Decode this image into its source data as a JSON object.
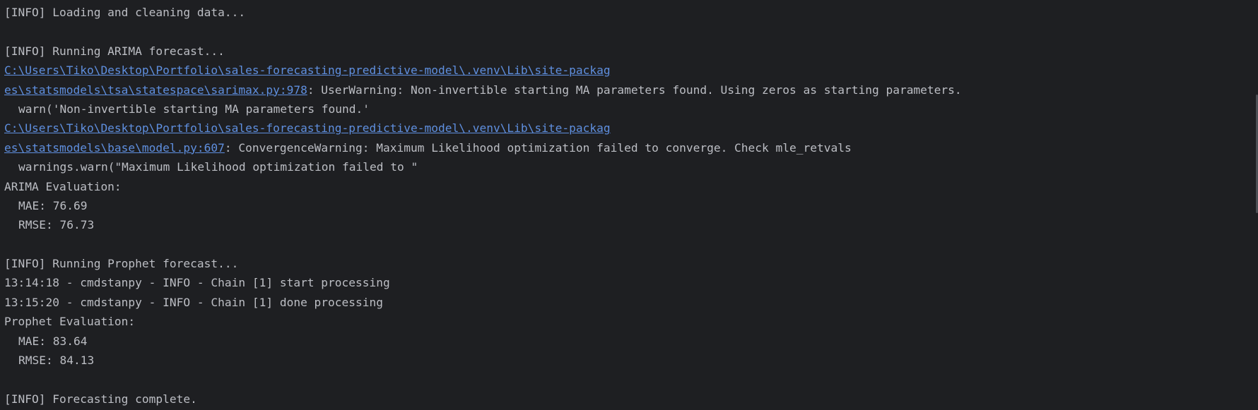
{
  "console": {
    "line1": "[INFO] Loading and cleaning data...",
    "line3": "[INFO] Running ARIMA forecast...",
    "warn1": {
      "link_part1": "C:\\Users\\Tiko\\Desktop\\Portfolio\\sales-forecasting-predictive-model\\.venv\\Lib\\site-packag",
      "link_part2": "es\\statsmodels\\tsa\\statespace\\sarimax.py:978",
      "message": ": UserWarning: Non-invertible starting MA parameters found. Using zeros as starting parameters.",
      "code": "warn('Non-invertible starting MA parameters found.'"
    },
    "warn2": {
      "link_part1": "C:\\Users\\Tiko\\Desktop\\Portfolio\\sales-forecasting-predictive-model\\.venv\\Lib\\site-packag",
      "link_part2": "es\\statsmodels\\base\\model.py:607",
      "message": ": ConvergenceWarning: Maximum Likelihood optimization failed to converge. Check mle_retvals",
      "code": "warnings.warn(\"Maximum Likelihood optimization failed to \""
    },
    "arima": {
      "title": "ARIMA Evaluation:",
      "mae": "MAE: 76.69",
      "rmse": "RMSE: 76.73"
    },
    "prophet_start": "[INFO] Running Prophet forecast...",
    "chain_start": "13:14:18 - cmdstanpy - INFO - Chain [1] start processing",
    "chain_done": "13:15:20 - cmdstanpy - INFO - Chain [1] done processing",
    "prophet": {
      "title": "Prophet Evaluation:",
      "mae": "MAE: 83.64",
      "rmse": "RMSE: 84.13"
    },
    "complete": "[INFO] Forecasting complete."
  },
  "colors": {
    "background": "#1e1f22",
    "text": "#bcbec4",
    "link": "#5f8fdf"
  }
}
